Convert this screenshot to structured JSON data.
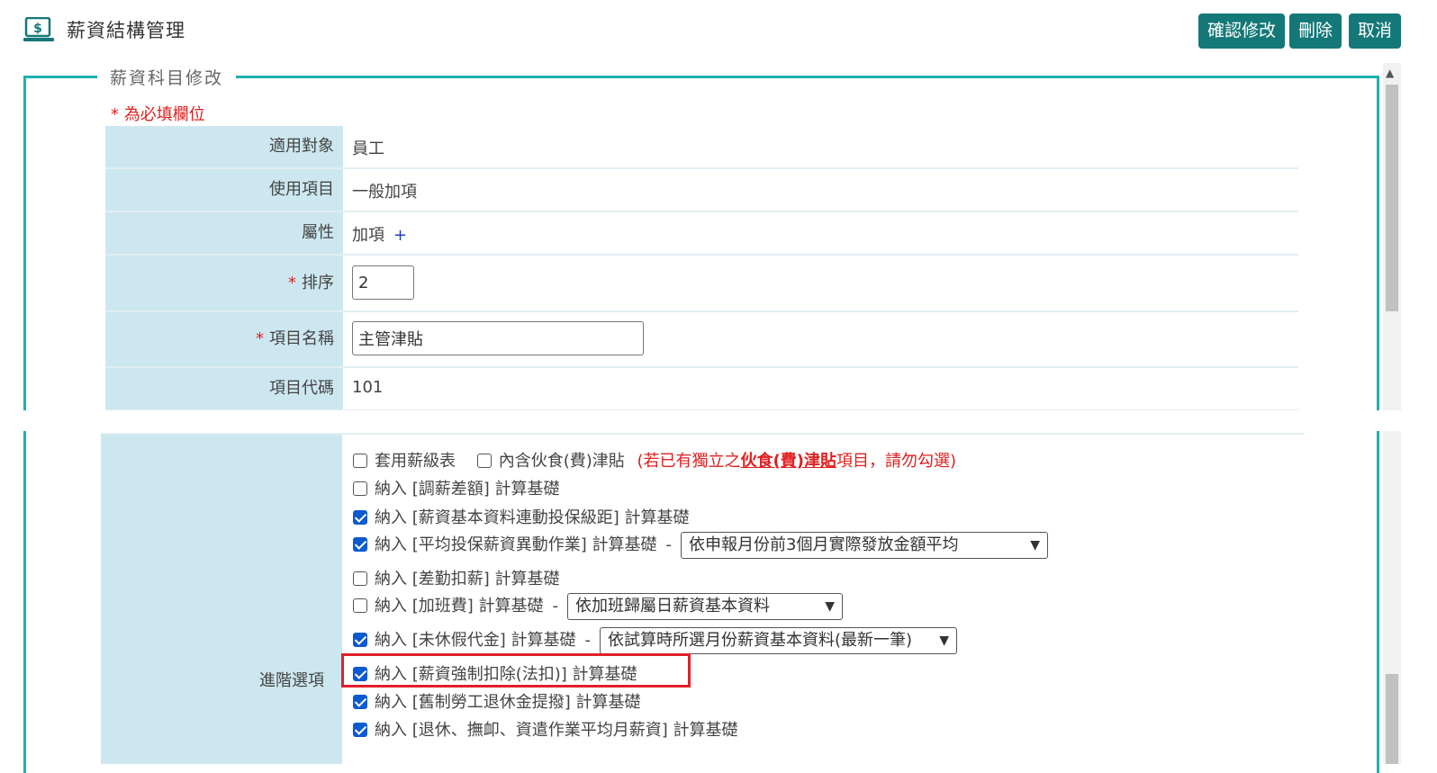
{
  "header": {
    "title": "薪資結構管理",
    "buttons": {
      "confirm": "確認修改",
      "delete": "刪除",
      "cancel": "取消"
    },
    "accent": "#157878"
  },
  "form": {
    "legend": "薪資科目修改",
    "required_note": "* 為必填欄位",
    "fields": {
      "target": {
        "label": "適用對象",
        "value": "員工"
      },
      "usage": {
        "label": "使用項目",
        "value": "一般加項"
      },
      "attribute": {
        "label": "屬性",
        "value": "加項",
        "suffix": "+"
      },
      "order": {
        "label": "排序",
        "value": "2"
      },
      "name": {
        "label": "項目名稱",
        "value": "主管津貼"
      },
      "code": {
        "label": "項目代碼",
        "value": "101"
      }
    },
    "star": "*"
  },
  "advanced": {
    "label": "進階選項",
    "options": [
      {
        "text": "套用薪級表",
        "checked": false
      },
      {
        "text": "內含伙食(費)津貼",
        "checked": false,
        "note_pre": "(若已有獨立之",
        "note_bold": "伙食(費)津貼",
        "note_post": "項目，請勿勾選)"
      },
      {
        "text": "納入 [調薪差額] 計算基礎",
        "checked": false
      },
      {
        "text": "納入 [薪資基本資料連動投保級距] 計算基礎",
        "checked": true
      },
      {
        "text": "納入 [平均投保薪資異動作業] 計算基礎",
        "checked": true,
        "select": "依申報月份前3個月實際發放金額平均"
      },
      {
        "text": "納入 [差勤扣薪] 計算基礎",
        "checked": false
      },
      {
        "text": "納入 [加班費] 計算基礎",
        "checked": false,
        "select": "依加班歸屬日薪資基本資料"
      },
      {
        "text": "納入 [未休假代金] 計算基礎",
        "checked": true,
        "select": "依試算時所選月份薪資基本資料(最新一筆)"
      },
      {
        "text": "納入 [薪資強制扣除(法扣)] 計算基礎",
        "checked": true
      },
      {
        "text": "納入 [舊制勞工退休金提撥] 計算基礎",
        "checked": true
      },
      {
        "text": "納入 [退休、撫卹、資遣作業平均月薪資] 計算基礎",
        "checked": true
      }
    ],
    "dash": "-"
  }
}
